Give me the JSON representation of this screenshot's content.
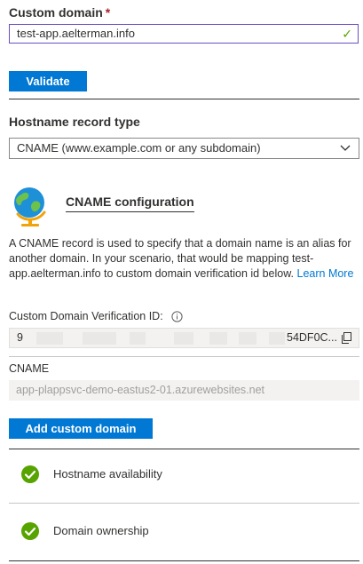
{
  "custom_domain": {
    "label": "Custom domain",
    "required_mark": "*",
    "value": "test-app.aelterman.info"
  },
  "validate_button": "Validate",
  "hostname_record": {
    "label": "Hostname record type",
    "selected": "CNAME (www.example.com or any subdomain)"
  },
  "cname_config": {
    "title": "CNAME configuration",
    "description": "A CNAME record is used to specify that a domain name is an alias for another domain. In your scenario, that would be mapping test-app.aelterman.info to custom domain verification id below.",
    "learn_more": "Learn More"
  },
  "verification": {
    "label": "Custom Domain Verification ID:",
    "value_start": "9",
    "value_end": "54DF0C..."
  },
  "cname": {
    "label": "CNAME",
    "value": "app-plappsvc-demo-eastus2-01.azurewebsites.net"
  },
  "add_button": "Add custom domain",
  "checks": [
    {
      "label": "Hostname availability",
      "status": "success"
    },
    {
      "label": "Domain ownership",
      "status": "success"
    }
  ],
  "colors": {
    "accent": "#0078d4",
    "success": "#57a300",
    "required": "#a4262c"
  }
}
